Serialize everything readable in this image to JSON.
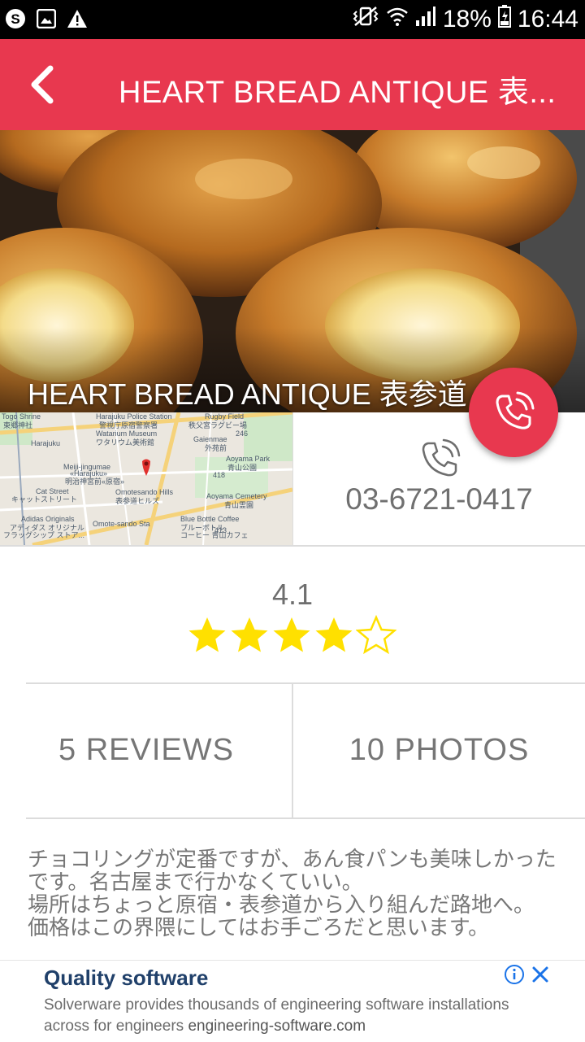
{
  "status_bar": {
    "battery_percent": "18%",
    "time": "16:44",
    "left_icons": [
      "skype-icon",
      "image-icon",
      "warning-icon"
    ],
    "right_icons": [
      "vibrate-icon",
      "wifi-icon",
      "signal-icon",
      "battery-icon"
    ]
  },
  "app_bar": {
    "title": "HEART BREAD ANTIQUE 表...",
    "back_icon": "back-arrow-icon",
    "color": "#e8384f"
  },
  "hero": {
    "title": "HEART BREAD ANTIQUE 表参道"
  },
  "map": {
    "labels": [
      "Togo Shrine",
      "東郷神社",
      "Harajuku Police Station",
      "警視庁原宿警察署",
      "Rugby Field",
      "秩父宮ラグビー場",
      "Watarium Museum",
      "ワタリウム美術館",
      "Gaienmae",
      "外苑前",
      "Harajuku",
      "Meiji-jingumae",
      "«Harajuku»",
      "明治神宮前«原宿»",
      "Aoyama Park",
      "青山公園",
      "Cat Street",
      "キャットストリート",
      "Omotesando Hills",
      "表参道ヒルズ",
      "Aoyama Cemetery",
      "青山霊園",
      "Adidas Originals",
      "アディダス オリジナル",
      "フラッグシップ ストア...",
      "Omote-sando Sta",
      "Blue Bottle Coffee",
      "ブルーボトル",
      "コーヒー 青山カフェ",
      "246",
      "418",
      "413"
    ]
  },
  "phone": {
    "number": "03-6721-0417"
  },
  "rating": {
    "value": "4.1",
    "stars_filled": 4,
    "stars_total": 5,
    "star_color": "#ffe000"
  },
  "stats": {
    "reviews": "5 REVIEWS",
    "photos": "10 PHOTOS"
  },
  "review": {
    "text": "チョコリングが定番ですが、あん食パンも美味しかったです。名古屋まで行かなくていい。\n場所はちょっと原宿・表参道から入り組んだ路地へ。\n価格はこの界隈にしてはお手ごろだと思います。"
  },
  "ad": {
    "title": "Quality software",
    "body": "Solverware provides thousands of engineering software installations across for engineers",
    "link": "engineering-software.com",
    "info_icon": "info-icon",
    "close_icon": "close-icon",
    "accent": "#1a73e8"
  }
}
